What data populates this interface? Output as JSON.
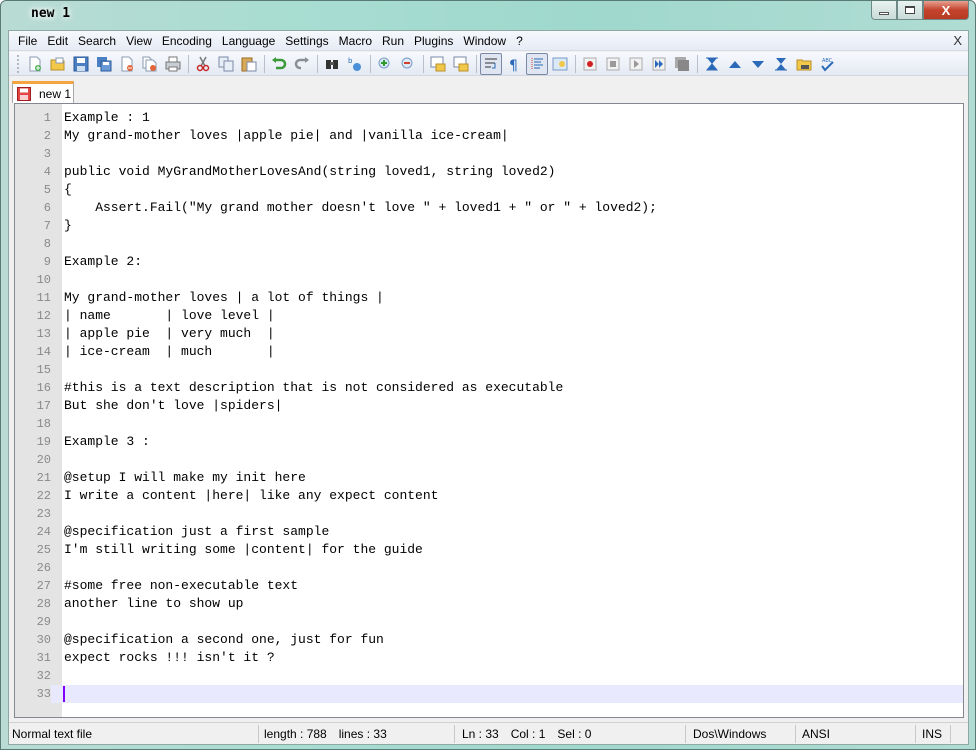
{
  "window": {
    "title": "new 1",
    "controls": {
      "minimize": "minimize",
      "maximize": "maximize",
      "close": "X"
    }
  },
  "menu": {
    "items": [
      "File",
      "Edit",
      "Search",
      "View",
      "Encoding",
      "Language",
      "Settings",
      "Macro",
      "Run",
      "Plugins",
      "Window",
      "?"
    ],
    "close_doc": "X"
  },
  "toolbar": {
    "buttons": [
      {
        "icon": "new-file-icon"
      },
      {
        "icon": "open-file-icon"
      },
      {
        "icon": "save-icon"
      },
      {
        "icon": "save-all-icon"
      },
      {
        "icon": "close-icon"
      },
      {
        "icon": "close-all-icon"
      },
      {
        "icon": "print-icon"
      },
      {
        "icon": "cut-icon"
      },
      {
        "icon": "copy-icon"
      },
      {
        "icon": "paste-icon"
      },
      {
        "icon": "undo-icon"
      },
      {
        "icon": "redo-icon"
      },
      {
        "icon": "find-icon"
      },
      {
        "icon": "replace-icon"
      },
      {
        "icon": "zoom-in-icon"
      },
      {
        "icon": "zoom-out-icon"
      },
      {
        "icon": "sync-vertical-icon"
      },
      {
        "icon": "sync-horizontal-icon"
      },
      {
        "icon": "word-wrap-icon"
      },
      {
        "icon": "show-all-characters-icon"
      },
      {
        "icon": "indent-guide-icon"
      },
      {
        "icon": "user-defined-language-icon"
      },
      {
        "icon": "record-macro-icon"
      },
      {
        "icon": "stop-record-icon"
      },
      {
        "icon": "play-macro-icon"
      },
      {
        "icon": "run-macro-multiple-icon"
      },
      {
        "icon": "save-macro-icon"
      },
      {
        "icon": "first-icon"
      },
      {
        "icon": "previous-icon"
      },
      {
        "icon": "next-icon"
      },
      {
        "icon": "last-icon"
      },
      {
        "icon": "plugin-icon"
      },
      {
        "icon": "spell-check-icon"
      }
    ]
  },
  "tabs": [
    {
      "label": "new 1",
      "icon": "unsaved-file-icon",
      "active": true
    }
  ],
  "editor": {
    "current_line": 33,
    "lines": [
      "Example : 1",
      "My grand-mother loves |apple pie| and |vanilla ice-cream|",
      "",
      "public void MyGrandMotherLovesAnd(string loved1, string loved2)",
      "{",
      "    Assert.Fail(\"My grand mother doesn't love \" + loved1 + \" or \" + loved2);",
      "}",
      "",
      "Example 2:",
      "",
      "My grand-mother loves | a lot of things |",
      "| name       | love level |",
      "| apple pie  | very much  |",
      "| ice-cream  | much       |",
      "",
      "#this is a text description that is not considered as executable",
      "But she don't love |spiders|",
      "",
      "Example 3 :",
      "",
      "@setup I will make my init here",
      "I write a content |here| like any expect content",
      "",
      "@specification just a first sample",
      "I'm still writing some |content| for the guide",
      "",
      "#some free non-executable text",
      "another line to show up",
      "",
      "@specification a second one, just for fun",
      "expect rocks !!! isn't it ?",
      "",
      ""
    ]
  },
  "status": {
    "file_type": "Normal text file",
    "length": "length : 788",
    "lines": "lines : 33",
    "ln": "Ln : 33",
    "col": "Col : 1",
    "sel": "Sel : 0",
    "eol": "Dos\\Windows",
    "encoding": "ANSI",
    "mode": "INS"
  }
}
